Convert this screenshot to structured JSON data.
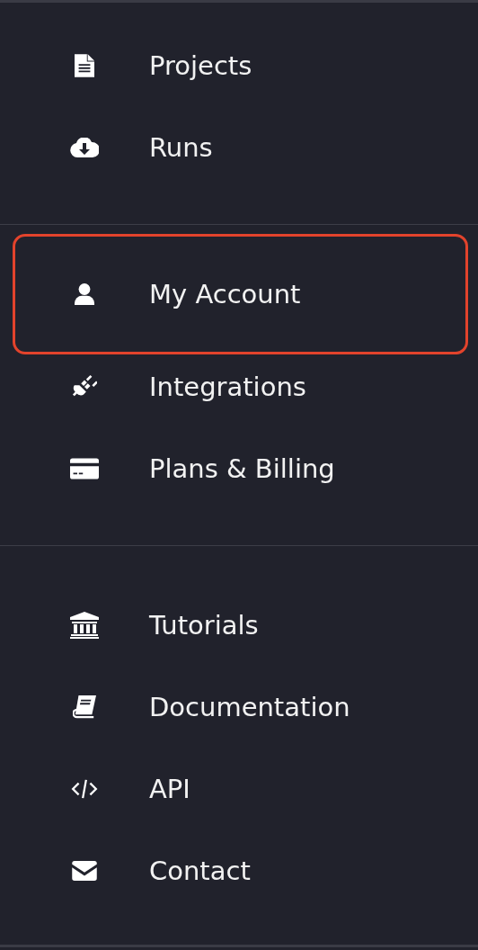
{
  "sidebar": {
    "sections": [
      {
        "items": [
          {
            "label": "Projects",
            "selected": false
          },
          {
            "label": "Runs",
            "selected": false
          }
        ]
      },
      {
        "items": [
          {
            "label": "My Account",
            "selected": true
          },
          {
            "label": "Integrations",
            "selected": false
          },
          {
            "label": "Plans & Billing",
            "selected": false
          }
        ]
      },
      {
        "items": [
          {
            "label": "Tutorials",
            "selected": false
          },
          {
            "label": "Documentation",
            "selected": false
          },
          {
            "label": "API",
            "selected": false
          },
          {
            "label": "Contact",
            "selected": false
          }
        ]
      }
    ]
  }
}
